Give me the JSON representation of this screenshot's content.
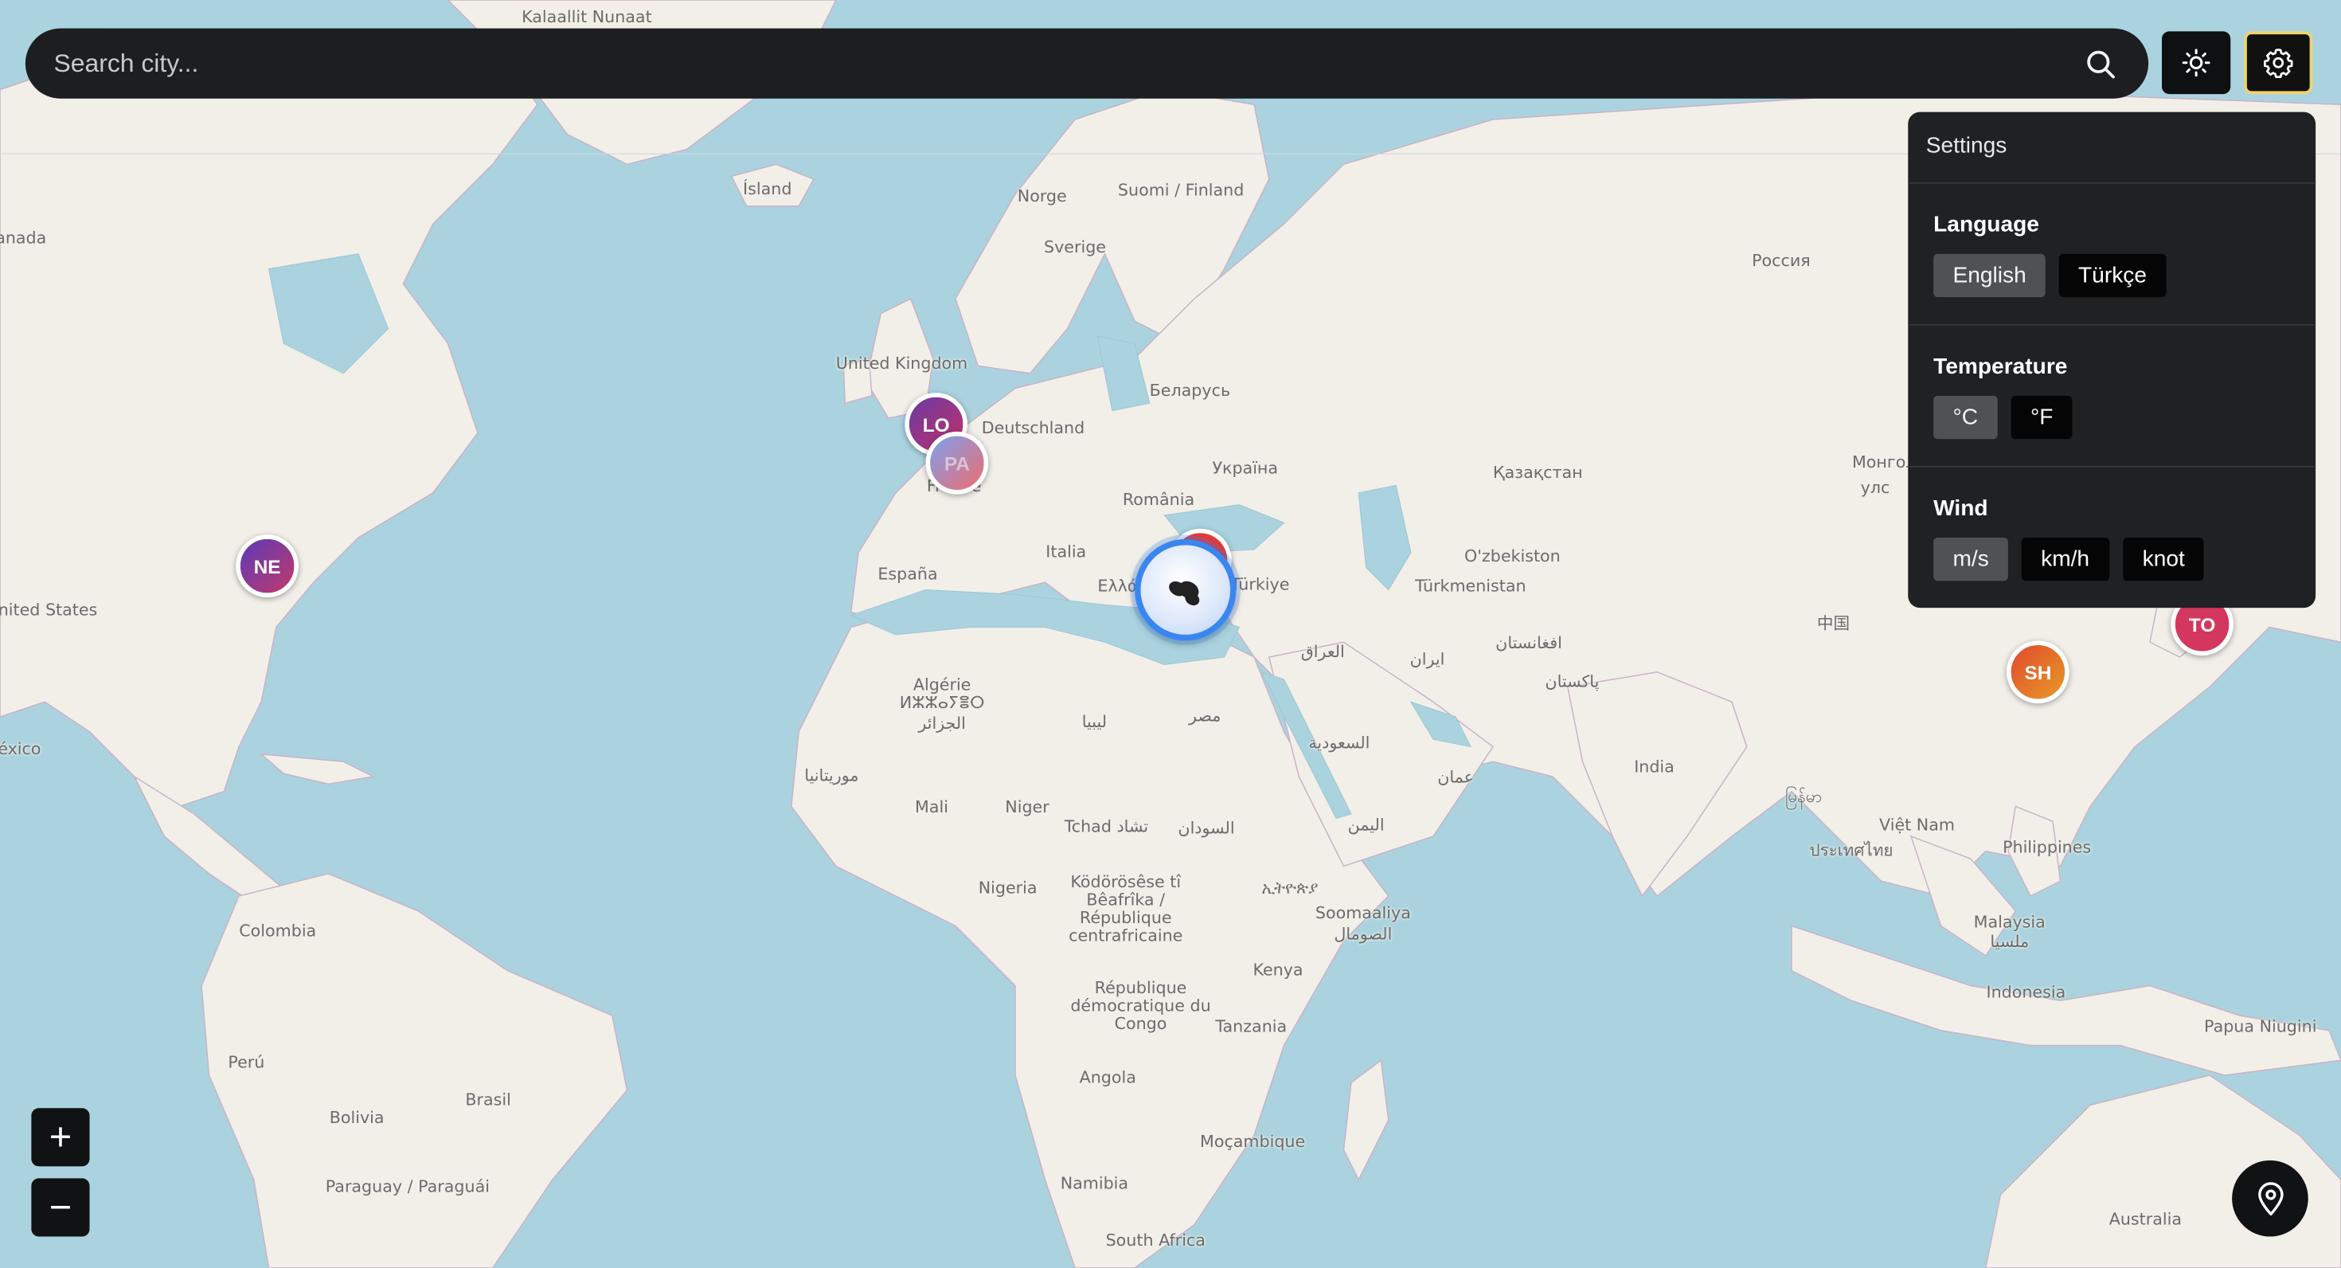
{
  "search": {
    "placeholder": "Search city..."
  },
  "header": {
    "theme_icon": "sun-icon",
    "settings_icon": "gear-icon"
  },
  "settings": {
    "title": "Settings",
    "language": {
      "label": "Language",
      "options": [
        "English",
        "Türkçe"
      ],
      "selected": "English"
    },
    "temperature": {
      "label": "Temperature",
      "options": [
        "°C",
        "°F"
      ],
      "selected": "°C"
    },
    "wind": {
      "label": "Wind",
      "options": [
        "m/s",
        "km/h",
        "knot"
      ],
      "selected": "m/s"
    }
  },
  "markers": [
    {
      "label": "LO",
      "colors": [
        "#6a3aa2",
        "#c2306b"
      ]
    },
    {
      "label": "PA",
      "colors": [
        "#7d9ff0",
        "#ef6d6d"
      ]
    },
    {
      "label": "NE",
      "colors": [
        "#5a3ab8",
        "#c23a6a"
      ]
    },
    {
      "label": "TO",
      "colors": [
        "#d3365e",
        "#d3365e"
      ]
    },
    {
      "label": "SH",
      "colors": [
        "#e0492f",
        "#e89a25"
      ]
    }
  ],
  "current_location_marker": {
    "icon": "cloud-icon",
    "color": "#3a86f0"
  },
  "zoom": {
    "in_label": "+",
    "out_label": "−"
  },
  "locate_icon": "location-pin-icon",
  "map_labels": [
    "Kalaallit Nunaat",
    "Ísland",
    "Norge",
    "Suomi / Finland",
    "Sverige",
    "Россия",
    "United Kingdom",
    "Deutschland",
    "Беларусь",
    "Україна",
    "France",
    "România",
    "Қазақстан",
    "Монгол",
    "улс",
    "Italia",
    "España",
    "Türkiye",
    "O'zbekiston",
    "Türkmenistan",
    "ایران",
    "افغانستان",
    "پاکستان",
    "العراق",
    "Algérie",
    "ⵍⵣⵣⴰⵢⴻⵔ",
    "الجزائر",
    "ليبيا",
    "مصر",
    "السعودية",
    "عمان",
    "اليمن",
    "موريتانيا",
    "Mali",
    "Niger",
    "Tchad تشاد",
    "السودان",
    "Nigeria",
    "ኢትዮጵያ",
    "Ködörösêse tî Bêafrîka / République centrafricaine",
    "Soomaaliya",
    "الصومال",
    "Kenya",
    "République démocratique du Congo",
    "Tanzania",
    "Angola",
    "Moçambique",
    "Namibia",
    "South Africa",
    "India",
    "中国",
    "မြန်မာ",
    "Việt Nam",
    "ประเทศไทย",
    "Philippines",
    "Malaysia",
    "ملسيا",
    "Indonesia",
    "Papua Niugini",
    "Australia",
    "anada",
    "nited States",
    "éxico",
    "Colombia",
    "Perú",
    "Brasil",
    "Bolivia",
    "Paraguay / Paraguái",
    "Ελλάς"
  ]
}
